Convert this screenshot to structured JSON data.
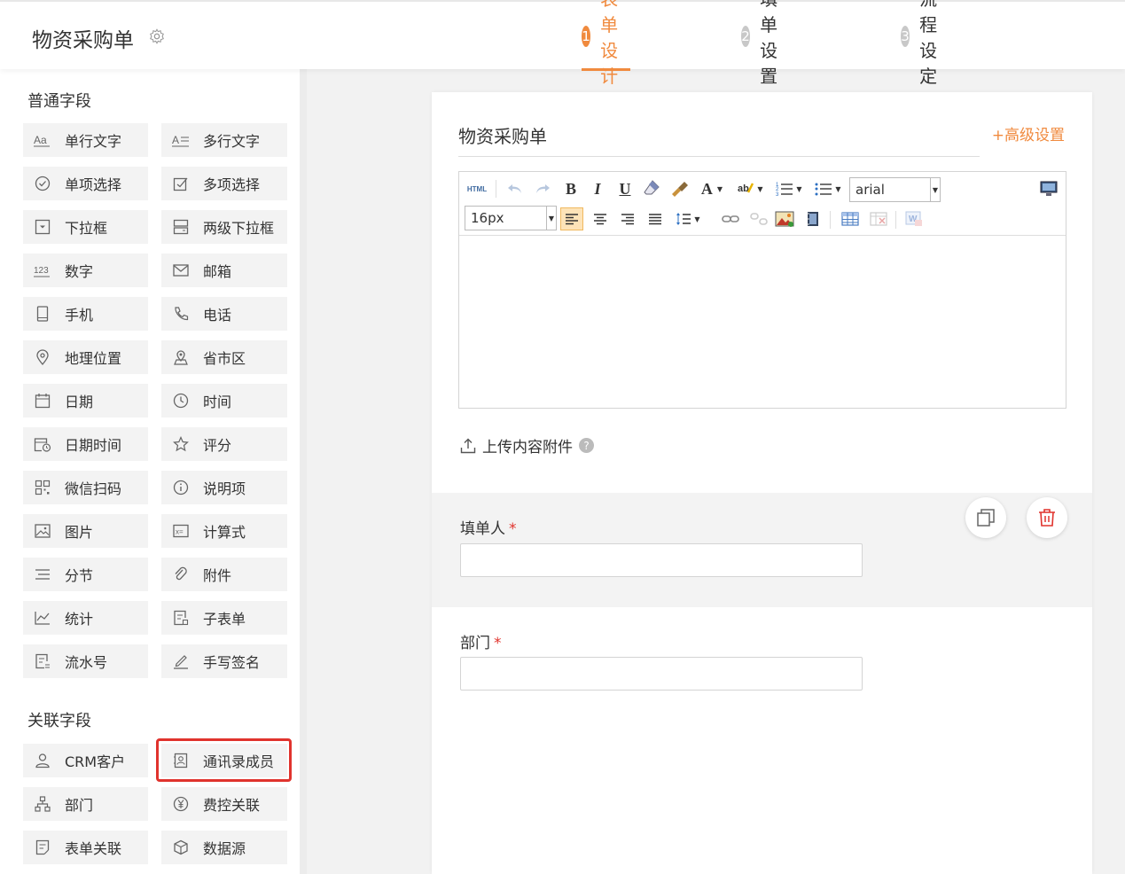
{
  "header": {
    "title": "物资采购单",
    "steps": [
      {
        "num": "1",
        "label": "表单设计",
        "active": true
      },
      {
        "num": "2",
        "label": "填单设置",
        "active": false
      },
      {
        "num": "3",
        "label": "流程设定",
        "active": false
      }
    ]
  },
  "sidebar": {
    "common_title": "普通字段",
    "common_fields": [
      {
        "label": "单行文字",
        "icon": "text-aa-icon"
      },
      {
        "label": "多行文字",
        "icon": "multiline-text-icon"
      },
      {
        "label": "单项选择",
        "icon": "radio-icon"
      },
      {
        "label": "多项选择",
        "icon": "checkbox-icon"
      },
      {
        "label": "下拉框",
        "icon": "dropdown-icon"
      },
      {
        "label": "两级下拉框",
        "icon": "cascade-dropdown-icon"
      },
      {
        "label": "数字",
        "icon": "number-123-icon"
      },
      {
        "label": "邮箱",
        "icon": "mail-icon"
      },
      {
        "label": "手机",
        "icon": "mobile-icon"
      },
      {
        "label": "电话",
        "icon": "phone-icon"
      },
      {
        "label": "地理位置",
        "icon": "location-pin-icon"
      },
      {
        "label": "省市区",
        "icon": "region-icon"
      },
      {
        "label": "日期",
        "icon": "calendar-icon"
      },
      {
        "label": "时间",
        "icon": "clock-icon"
      },
      {
        "label": "日期时间",
        "icon": "datetime-icon"
      },
      {
        "label": "评分",
        "icon": "star-icon"
      },
      {
        "label": "微信扫码",
        "icon": "qrcode-icon"
      },
      {
        "label": "说明项",
        "icon": "info-icon"
      },
      {
        "label": "图片",
        "icon": "image-icon"
      },
      {
        "label": "计算式",
        "icon": "formula-icon"
      },
      {
        "label": "分节",
        "icon": "section-icon"
      },
      {
        "label": "附件",
        "icon": "paperclip-icon"
      },
      {
        "label": "统计",
        "icon": "stats-chart-icon"
      },
      {
        "label": "子表单",
        "icon": "subform-icon"
      },
      {
        "label": "流水号",
        "icon": "serial-number-icon"
      },
      {
        "label": "手写签名",
        "icon": "signature-pen-icon"
      }
    ],
    "related_title": "关联字段",
    "related_fields": [
      {
        "label": "CRM客户",
        "icon": "user-icon"
      },
      {
        "label": "通讯录成员",
        "icon": "contact-card-icon"
      },
      {
        "label": "部门",
        "icon": "org-chart-icon"
      },
      {
        "label": "费控关联",
        "icon": "yen-circle-icon"
      },
      {
        "label": "表单关联",
        "icon": "form-link-icon"
      },
      {
        "label": "数据源",
        "icon": "cube-icon"
      }
    ]
  },
  "form": {
    "title": "物资采购单",
    "advanced_label": "+高级设置",
    "editor": {
      "font_family": "arial",
      "font_size": "16px",
      "html_label": "HTML",
      "bold": "B",
      "italic": "I",
      "underline": "U",
      "font_color": "A"
    },
    "upload_label": "上传内容附件",
    "upload_help": "?",
    "fields": [
      {
        "label": "填单人",
        "required_mark": "*",
        "value": ""
      },
      {
        "label": "部门",
        "required_mark": "*",
        "value": ""
      }
    ]
  },
  "colors": {
    "accent": "#f08a3e",
    "required": "#e0332d",
    "highlight": "#e0332d"
  }
}
